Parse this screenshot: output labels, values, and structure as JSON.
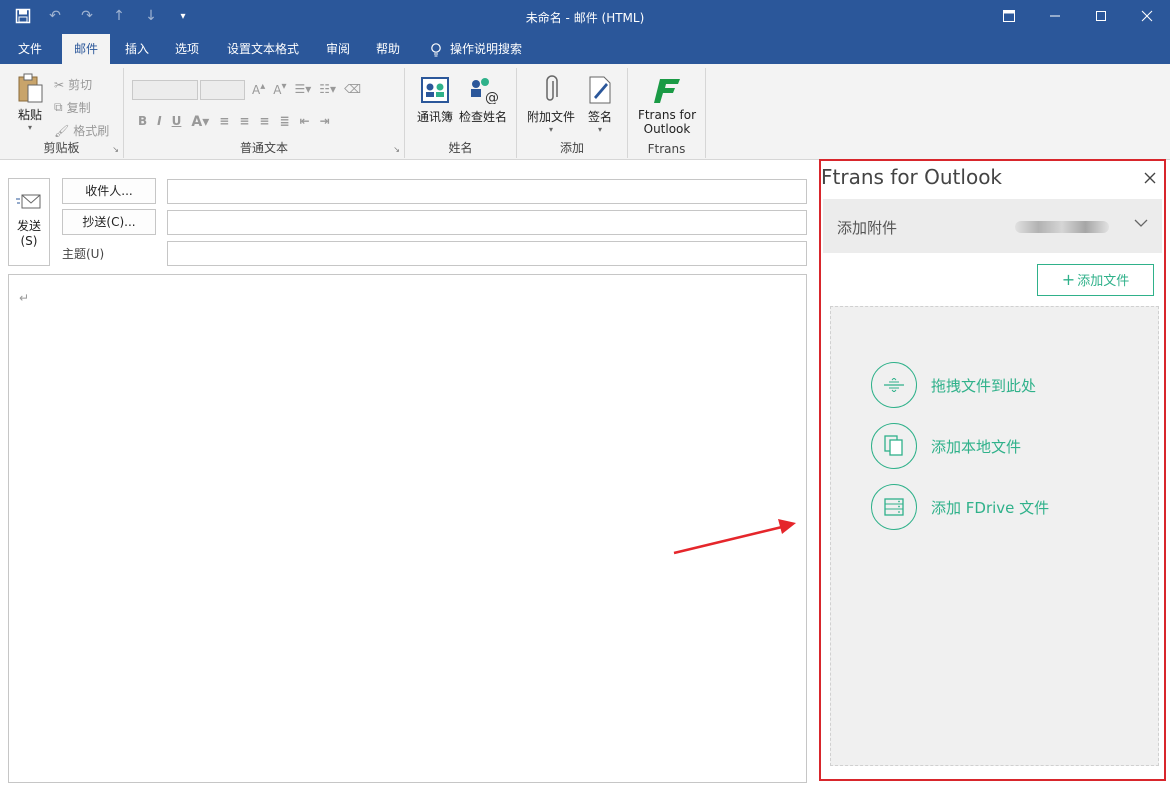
{
  "window": {
    "title": "未命名  -  邮件 (HTML)"
  },
  "tabs": [
    {
      "label": "文件"
    },
    {
      "label": "邮件"
    },
    {
      "label": "插入"
    },
    {
      "label": "选项"
    },
    {
      "label": "设置文本格式"
    },
    {
      "label": "审阅"
    },
    {
      "label": "帮助"
    }
  ],
  "tell_me": "操作说明搜索",
  "ribbon": {
    "clipboard": {
      "paste": "粘贴",
      "cut": "剪切",
      "copy": "复制",
      "format_painter": "格式刷",
      "group_label": "剪贴板"
    },
    "basic_text": {
      "bold": "B",
      "italic": "I",
      "underline": "U",
      "group_label": "普通文本"
    },
    "names": {
      "address_book": "通讯簿",
      "check_names": "检查姓名",
      "group_label": "姓名"
    },
    "include": {
      "attach_file": "附加文件",
      "signature": "签名",
      "group_label": "添加"
    },
    "ftrans": {
      "button_line1": "Ftrans for",
      "button_line2": "Outlook",
      "group_label": "Ftrans"
    }
  },
  "compose": {
    "send_line1": "发送",
    "send_line2": "(S)",
    "to_button": "收件人...",
    "cc_button": "抄送(C)...",
    "subject_label": "主题(U)",
    "paragraph_mark": "↵"
  },
  "pane": {
    "title": "Ftrans for Outlook",
    "attach_label": "添加附件",
    "add_file_button": "添加文件",
    "actions": [
      {
        "label": "拖拽文件到此处",
        "icon": "drag-drop-icon"
      },
      {
        "label": "添加本地文件",
        "icon": "local-files-icon"
      },
      {
        "label": "添加 FDrive 文件",
        "icon": "fdrive-icon"
      }
    ]
  },
  "colors": {
    "accent_blue": "#2b579a",
    "ftrans_green": "#2fb18a",
    "highlight_red": "#d8262c"
  }
}
